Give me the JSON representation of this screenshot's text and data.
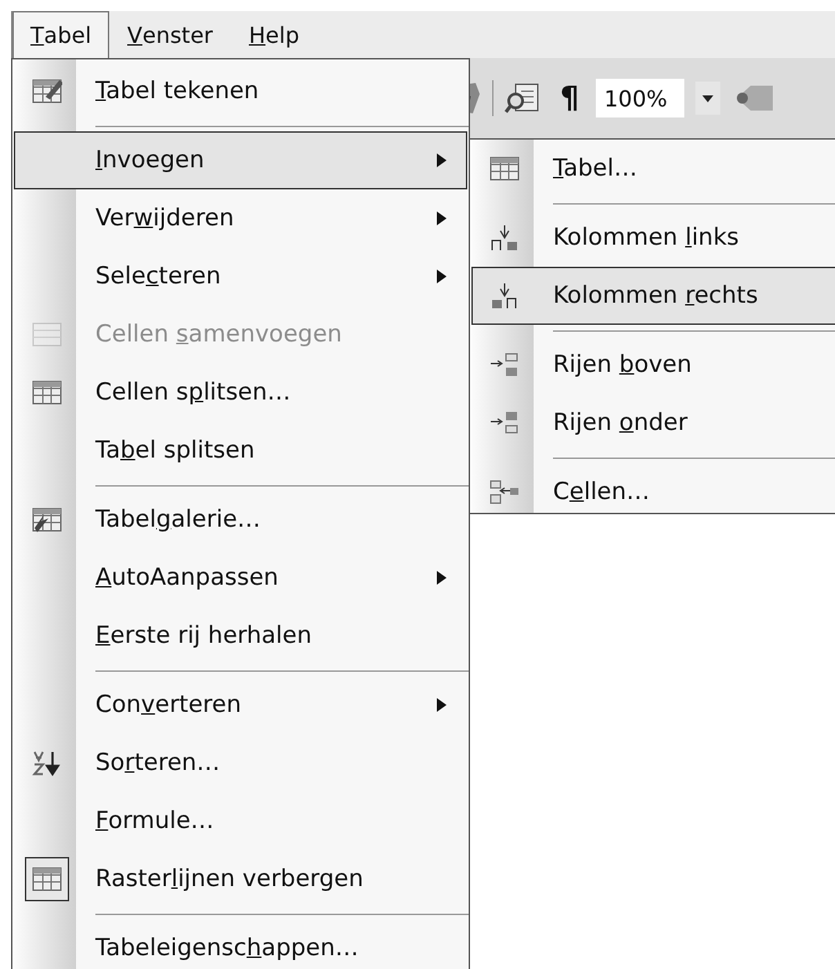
{
  "menu_bar": [
    {
      "label": {
        "key": "T",
        "after": "abel"
      },
      "selected": true
    },
    {
      "label": {
        "key": "V",
        "after": "enster"
      },
      "selected": false
    },
    {
      "label": {
        "key": "H",
        "after": "elp"
      },
      "selected": false
    }
  ],
  "toolbar": {
    "pilcrow": "¶",
    "zoom_field": {
      "value": "100%"
    }
  },
  "menu": [
    {
      "label": {
        "key": "T",
        "after": "abel tekenen"
      },
      "selected": false,
      "disabled": false,
      "checked": false,
      "has_submenu": false,
      "separator_after": true
    },
    {
      "label": {
        "key": "I",
        "after": "nvoegen"
      },
      "selected": true,
      "disabled": false,
      "checked": false,
      "has_submenu": true,
      "separator_after": false
    },
    {
      "label": {
        "before": "Ver",
        "key": "w",
        "after": "ijderen"
      },
      "selected": false,
      "disabled": false,
      "checked": false,
      "has_submenu": true,
      "separator_after": false
    },
    {
      "label": {
        "before": "Sele",
        "key": "c",
        "after": "teren"
      },
      "selected": false,
      "disabled": false,
      "checked": false,
      "has_submenu": true,
      "separator_after": false
    },
    {
      "label": {
        "before": "Cellen ",
        "key": "s",
        "after": "amenvoegen"
      },
      "selected": false,
      "disabled": true,
      "checked": false,
      "has_submenu": false,
      "separator_after": false
    },
    {
      "label": {
        "before": "Cellen s",
        "key": "p",
        "after": "litsen…"
      },
      "selected": false,
      "disabled": false,
      "checked": false,
      "has_submenu": false,
      "separator_after": false
    },
    {
      "label": {
        "before": "Ta",
        "key": "b",
        "after": "el splitsen"
      },
      "selected": false,
      "disabled": false,
      "checked": false,
      "has_submenu": false,
      "separator_after": true
    },
    {
      "label": {
        "before": "Tabel",
        "key": "g",
        "after": "alerie…"
      },
      "selected": false,
      "disabled": false,
      "checked": false,
      "has_submenu": false,
      "separator_after": false
    },
    {
      "label": {
        "key": "A",
        "after": "utoAanpassen"
      },
      "selected": false,
      "disabled": false,
      "checked": false,
      "has_submenu": true,
      "separator_after": false
    },
    {
      "label": {
        "key": "E",
        "after": "erste rij herhalen"
      },
      "selected": false,
      "disabled": false,
      "checked": false,
      "has_submenu": false,
      "separator_after": true
    },
    {
      "label": {
        "before": "Con",
        "key": "v",
        "after": "erteren"
      },
      "selected": false,
      "disabled": false,
      "checked": false,
      "has_submenu": true,
      "separator_after": false
    },
    {
      "label": {
        "before": "So",
        "key": "r",
        "after": "teren…"
      },
      "selected": false,
      "disabled": false,
      "checked": false,
      "has_submenu": false,
      "separator_after": false
    },
    {
      "label": {
        "key": "F",
        "after": "ormule…"
      },
      "selected": false,
      "disabled": false,
      "checked": false,
      "has_submenu": false,
      "separator_after": false
    },
    {
      "label": {
        "before": "Raster",
        "key": "l",
        "after": "ijnen verbergen"
      },
      "selected": false,
      "disabled": false,
      "checked": true,
      "has_submenu": false,
      "separator_after": true
    },
    {
      "label": {
        "before": "Tabeleigensc",
        "key": "h",
        "after": "appen…"
      },
      "selected": false,
      "disabled": false,
      "checked": false,
      "has_submenu": false,
      "separator_after": false
    }
  ],
  "submenu": [
    {
      "label": {
        "key": "T",
        "after": "abel…"
      },
      "selected": false,
      "separator_after": true
    },
    {
      "label": {
        "before": "Kolommen ",
        "key": "l",
        "after": "inks"
      },
      "selected": false,
      "separator_after": false
    },
    {
      "label": {
        "before": "Kolommen ",
        "key": "r",
        "after": "echts"
      },
      "selected": true,
      "separator_after": true
    },
    {
      "label": {
        "before": "Rijen ",
        "key": "b",
        "after": "oven"
      },
      "selected": false,
      "separator_after": false
    },
    {
      "label": {
        "before": "Rijen ",
        "key": "o",
        "after": "nder"
      },
      "selected": false,
      "separator_after": true
    },
    {
      "label": {
        "before": "C",
        "key": "e",
        "after": "llen…"
      },
      "selected": false,
      "separator_after": false
    }
  ]
}
